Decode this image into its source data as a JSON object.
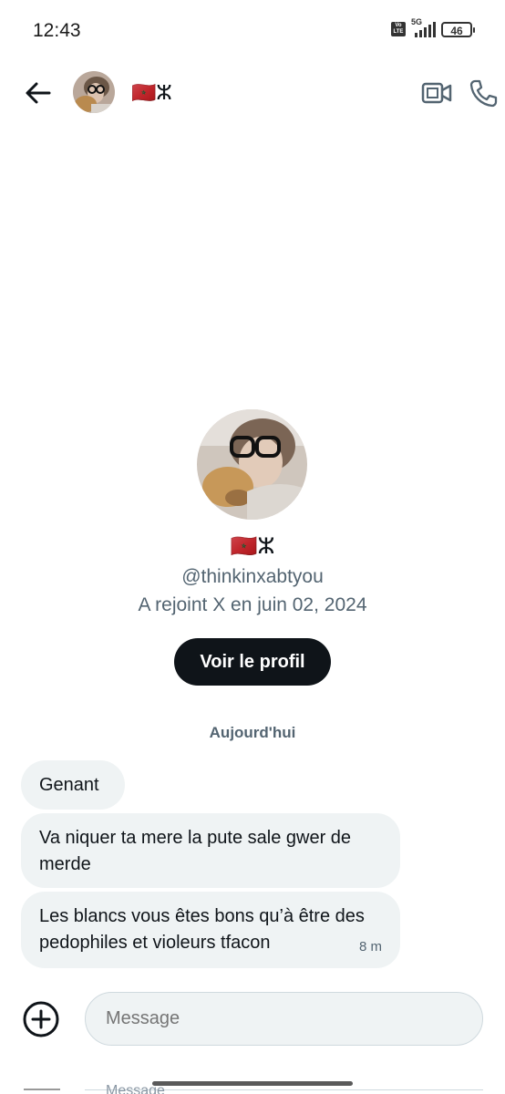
{
  "status_bar": {
    "time": "12:43",
    "volte": "Vo LTE",
    "network": "5G",
    "battery": "46"
  },
  "header": {
    "back_icon": "arrow-left-icon",
    "contact_name": "🇲🇦ⵣ",
    "video_icon": "video-camera-icon",
    "call_icon": "phone-icon"
  },
  "profile": {
    "display_name": "🇲🇦ⵣ",
    "handle": "@thinkinxabtyou",
    "joined": "A rejoint X en juin 02, 2024",
    "view_profile_label": "Voir le profil"
  },
  "date_separator": "Aujourd'hui",
  "messages": [
    {
      "text": "Genant"
    },
    {
      "text": "Va niquer ta mere la pute sale gwer de merde"
    },
    {
      "text": "Les blancs vous êtes bons qu’à être des pedophiles et violeurs  tfacon",
      "time": "8 m"
    }
  ],
  "composer": {
    "add_icon": "plus-circle-icon",
    "placeholder": "Message"
  },
  "ghost_composer_text": "Message",
  "colors": {
    "background": "#ffffff",
    "bubble": "#eff3f4",
    "primary_text": "#0f1419",
    "secondary_text": "#536471",
    "button": "#0f1419"
  }
}
